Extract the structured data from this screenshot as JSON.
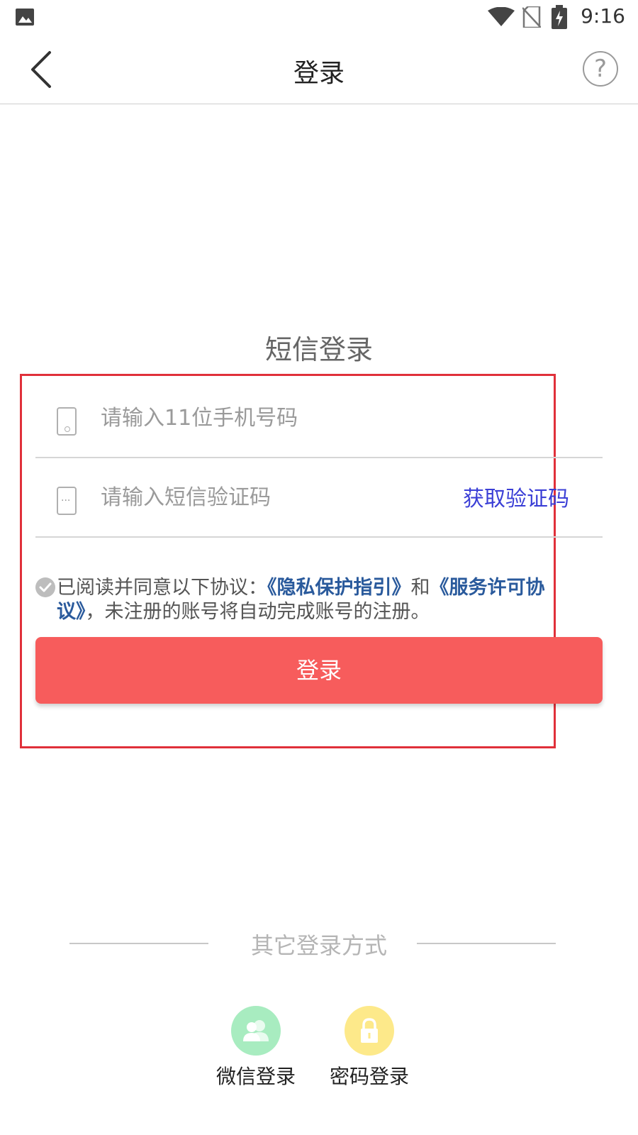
{
  "status_bar": {
    "time": "9:16",
    "icons": [
      "image-icon",
      "wifi-icon",
      "no-sim-icon",
      "battery-charging-icon"
    ]
  },
  "header": {
    "title": "登录",
    "back_icon": "chevron-left-icon",
    "help_icon": "help-icon",
    "help_glyph": "?"
  },
  "form": {
    "section_title": "短信登录",
    "phone": {
      "placeholder": "请输入11位手机号码",
      "value": "",
      "icon": "phone-icon"
    },
    "code": {
      "placeholder": "请输入短信验证码",
      "value": "",
      "icon": "message-dots-icon"
    },
    "get_code_label": "获取验证码",
    "agreement": {
      "prefix": "已阅读并同意以下协议：",
      "privacy_link": "《隐私保护指引》",
      "conjunction": "和",
      "service_link": "《服务许可协议》",
      "suffix": "，未注册的账号将自动完成账号的注册。"
    },
    "login_label": "登录"
  },
  "alt_login": {
    "title": "其它登录方式",
    "options": [
      {
        "label": "微信登录",
        "icon": "users-icon",
        "color": "#a8ecc0"
      },
      {
        "label": "密码登录",
        "icon": "lock-icon",
        "color": "#fde98a"
      }
    ]
  },
  "colors": {
    "primary_button": "#f75c5c",
    "link_blue": "#3b3fd6",
    "agreement_link": "#2a5a9c",
    "highlight_border": "#e0303a"
  }
}
